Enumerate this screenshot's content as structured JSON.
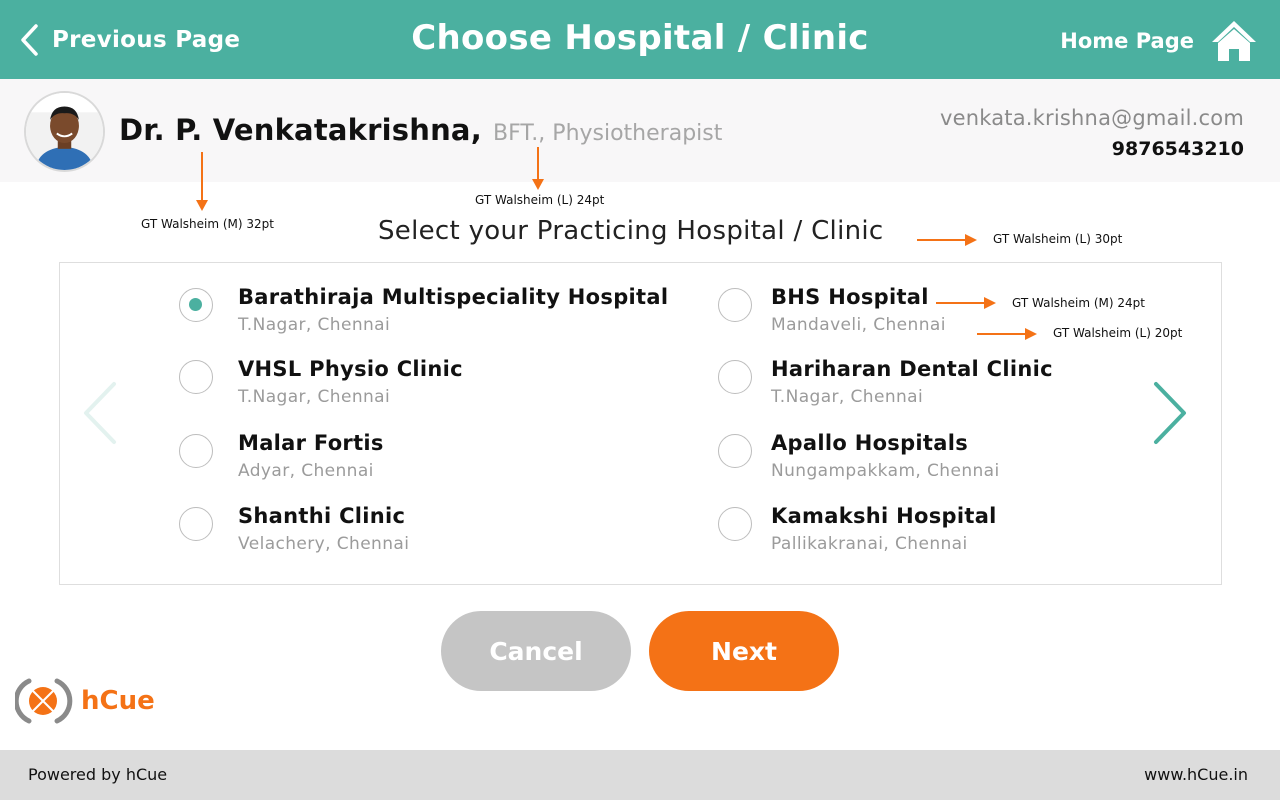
{
  "header": {
    "previous_label": "Previous Page",
    "title": "Choose Hospital / Clinic",
    "home_label": "Home Page"
  },
  "doctor": {
    "name": "Dr. P. Venkatakrishna,",
    "qualification": "BFT.,",
    "specialty": "Physiotherapist",
    "email": "venkata.krishna@gmail.com",
    "phone": "9876543210"
  },
  "annotations": {
    "name_font": "GT Walsheim (M) 32pt",
    "specialty_font": "GT Walsheim (L) 24pt",
    "subtitle_font": "GT Walsheim (L) 30pt",
    "option_name_font": "GT Walsheim (M) 24pt",
    "option_loc_font": "GT Walsheim (L) 20pt"
  },
  "subtitle": "Select your Practicing Hospital / Clinic",
  "options": [
    {
      "name": "Barathiraja Multispeciality Hospital",
      "location": "T.Nagar, Chennai",
      "selected": true
    },
    {
      "name": "VHSL Physio Clinic",
      "location": "T.Nagar, Chennai",
      "selected": false
    },
    {
      "name": "Malar Fortis",
      "location": "Adyar, Chennai",
      "selected": false
    },
    {
      "name": "Shanthi Clinic",
      "location": "Velachery, Chennai",
      "selected": false
    },
    {
      "name": "BHS Hospital",
      "location": "Mandaveli, Chennai",
      "selected": false
    },
    {
      "name": "Hariharan Dental Clinic",
      "location": "T.Nagar, Chennai",
      "selected": false
    },
    {
      "name": "Apallo Hospitals",
      "location": "Nungampakkam, Chennai",
      "selected": false
    },
    {
      "name": "Kamakshi Hospital",
      "location": "Pallikakranai, Chennai",
      "selected": false
    }
  ],
  "actions": {
    "cancel_label": "Cancel",
    "next_label": "Next"
  },
  "brand": {
    "logo_text": "hCue",
    "powered_by": "Powered by hCue",
    "website": "www.hCue.in"
  },
  "colors": {
    "header_teal": "#4bb0a0",
    "accent_orange": "#f47216",
    "cancel_grey": "#c5c5c5"
  },
  "icons": {
    "back": "chevron-left-icon",
    "home": "home-icon",
    "nav_prev": "chevron-left-icon",
    "nav_next": "chevron-right-icon"
  }
}
